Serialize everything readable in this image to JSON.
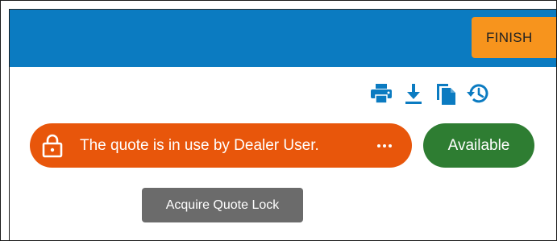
{
  "header": {
    "finish_label": "FINISH"
  },
  "toolbar": {
    "icons": [
      "print-icon",
      "download-icon",
      "copy-icon",
      "history-icon"
    ]
  },
  "lock_banner": {
    "text": "The quote is in use by Dealer User.",
    "more_label": "•••"
  },
  "status": {
    "label": "Available"
  },
  "tooltip": {
    "text": "Acquire Quote Lock"
  },
  "colors": {
    "header_bg": "#0b7bc1",
    "finish_bg": "#f7941d",
    "icon_color": "#0b7bc1",
    "lock_bg": "#e8560b",
    "status_bg": "#2e7d32",
    "tooltip_bg": "#6b6b6b"
  }
}
